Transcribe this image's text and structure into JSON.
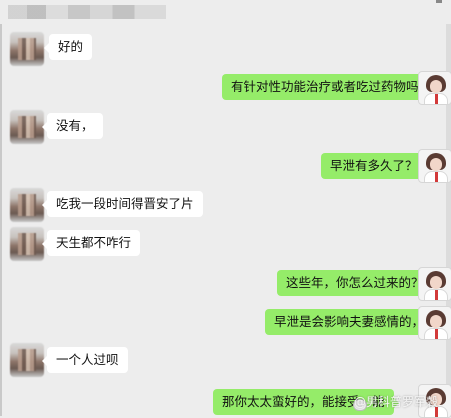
{
  "colors": {
    "background": "#ededed",
    "sent_bubble": "#95ec69",
    "received_bubble": "#ffffff"
  },
  "chat": {
    "messages": [
      {
        "side": "left",
        "text": "好的",
        "avatar": "contact-avatar-blurred"
      },
      {
        "side": "right",
        "text": "有针对性功能治疗或者吃过药物吗？",
        "avatar": "doctor-avatar"
      },
      {
        "side": "left",
        "text": "没有，",
        "avatar": "contact-avatar-blurred"
      },
      {
        "side": "right",
        "text": "早泄有多久了？",
        "avatar": "doctor-avatar"
      },
      {
        "side": "left",
        "text": "吃我一段时间得晋安了片",
        "avatar": "contact-avatar-blurred"
      },
      {
        "side": "left",
        "text": "天生都不咋行",
        "avatar": "contact-avatar-blurred"
      },
      {
        "side": "right",
        "text": "这些年，你怎么过来的？",
        "avatar": "doctor-avatar"
      },
      {
        "side": "right",
        "text": "早泄是会影响夫妻感情的，",
        "avatar": "doctor-avatar"
      },
      {
        "side": "left",
        "text": "一个人过呗",
        "avatar": "contact-avatar-blurred"
      },
      {
        "side": "right",
        "text": "那你太太蛮好的，能接受，能",
        "avatar": "doctor-avatar"
      }
    ]
  },
  "watermark": {
    "text": "@男科普罗军穀",
    "icon": "weibo-logo-icon"
  }
}
